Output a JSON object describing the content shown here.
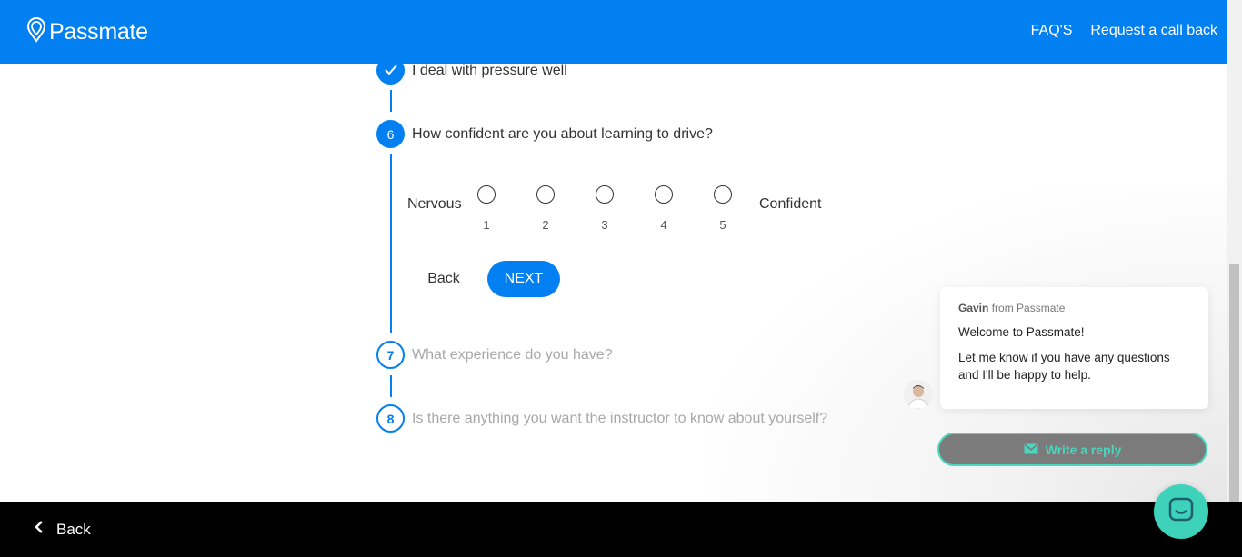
{
  "header": {
    "brand": "Passmate",
    "nav": {
      "faqs": "FAQ'S",
      "callback": "Request a call back"
    }
  },
  "steps": {
    "step5": {
      "text": "I deal with pressure well"
    },
    "step6": {
      "number": "6",
      "text": "How confident are you about learning to drive?"
    },
    "step7": {
      "number": "7",
      "text": "What experience do you have?"
    },
    "step8": {
      "number": "8",
      "text": "Is there anything you want the instructor to know about yourself?"
    }
  },
  "scale": {
    "low_label": "Nervous",
    "high_label": "Confident",
    "options": [
      "1",
      "2",
      "3",
      "4",
      "5"
    ],
    "selected": null
  },
  "buttons": {
    "back": "Back",
    "next": "NEXT"
  },
  "chat": {
    "sender": "Gavin",
    "from_text": "from Passmate",
    "welcome": "Welcome to Passmate!",
    "message": "Let me know if you have any questions and I'll be happy to help.",
    "reply_label": "Write a reply"
  },
  "footer": {
    "back": "Back"
  },
  "colors": {
    "primary": "#0280f2",
    "accent": "#3fd2bb",
    "footer": "#000000"
  }
}
